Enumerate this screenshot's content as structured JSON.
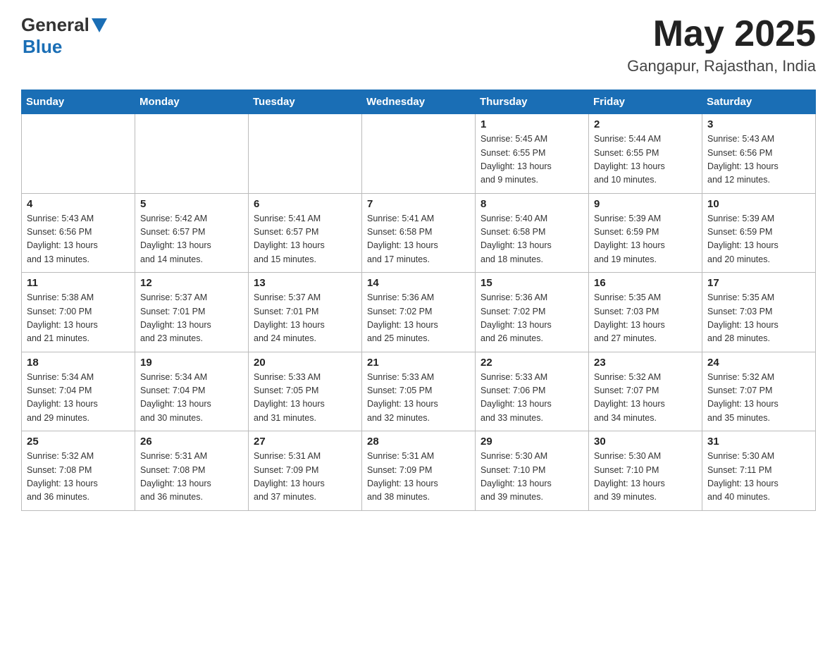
{
  "header": {
    "logo": {
      "general": "General",
      "blue": "Blue"
    },
    "title": "May 2025",
    "location": "Gangapur, Rajasthan, India"
  },
  "weekdays": [
    "Sunday",
    "Monday",
    "Tuesday",
    "Wednesday",
    "Thursday",
    "Friday",
    "Saturday"
  ],
  "weeks": [
    [
      {
        "day": "",
        "info": ""
      },
      {
        "day": "",
        "info": ""
      },
      {
        "day": "",
        "info": ""
      },
      {
        "day": "",
        "info": ""
      },
      {
        "day": "1",
        "info": "Sunrise: 5:45 AM\nSunset: 6:55 PM\nDaylight: 13 hours\nand 9 minutes."
      },
      {
        "day": "2",
        "info": "Sunrise: 5:44 AM\nSunset: 6:55 PM\nDaylight: 13 hours\nand 10 minutes."
      },
      {
        "day": "3",
        "info": "Sunrise: 5:43 AM\nSunset: 6:56 PM\nDaylight: 13 hours\nand 12 minutes."
      }
    ],
    [
      {
        "day": "4",
        "info": "Sunrise: 5:43 AM\nSunset: 6:56 PM\nDaylight: 13 hours\nand 13 minutes."
      },
      {
        "day": "5",
        "info": "Sunrise: 5:42 AM\nSunset: 6:57 PM\nDaylight: 13 hours\nand 14 minutes."
      },
      {
        "day": "6",
        "info": "Sunrise: 5:41 AM\nSunset: 6:57 PM\nDaylight: 13 hours\nand 15 minutes."
      },
      {
        "day": "7",
        "info": "Sunrise: 5:41 AM\nSunset: 6:58 PM\nDaylight: 13 hours\nand 17 minutes."
      },
      {
        "day": "8",
        "info": "Sunrise: 5:40 AM\nSunset: 6:58 PM\nDaylight: 13 hours\nand 18 minutes."
      },
      {
        "day": "9",
        "info": "Sunrise: 5:39 AM\nSunset: 6:59 PM\nDaylight: 13 hours\nand 19 minutes."
      },
      {
        "day": "10",
        "info": "Sunrise: 5:39 AM\nSunset: 6:59 PM\nDaylight: 13 hours\nand 20 minutes."
      }
    ],
    [
      {
        "day": "11",
        "info": "Sunrise: 5:38 AM\nSunset: 7:00 PM\nDaylight: 13 hours\nand 21 minutes."
      },
      {
        "day": "12",
        "info": "Sunrise: 5:37 AM\nSunset: 7:01 PM\nDaylight: 13 hours\nand 23 minutes."
      },
      {
        "day": "13",
        "info": "Sunrise: 5:37 AM\nSunset: 7:01 PM\nDaylight: 13 hours\nand 24 minutes."
      },
      {
        "day": "14",
        "info": "Sunrise: 5:36 AM\nSunset: 7:02 PM\nDaylight: 13 hours\nand 25 minutes."
      },
      {
        "day": "15",
        "info": "Sunrise: 5:36 AM\nSunset: 7:02 PM\nDaylight: 13 hours\nand 26 minutes."
      },
      {
        "day": "16",
        "info": "Sunrise: 5:35 AM\nSunset: 7:03 PM\nDaylight: 13 hours\nand 27 minutes."
      },
      {
        "day": "17",
        "info": "Sunrise: 5:35 AM\nSunset: 7:03 PM\nDaylight: 13 hours\nand 28 minutes."
      }
    ],
    [
      {
        "day": "18",
        "info": "Sunrise: 5:34 AM\nSunset: 7:04 PM\nDaylight: 13 hours\nand 29 minutes."
      },
      {
        "day": "19",
        "info": "Sunrise: 5:34 AM\nSunset: 7:04 PM\nDaylight: 13 hours\nand 30 minutes."
      },
      {
        "day": "20",
        "info": "Sunrise: 5:33 AM\nSunset: 7:05 PM\nDaylight: 13 hours\nand 31 minutes."
      },
      {
        "day": "21",
        "info": "Sunrise: 5:33 AM\nSunset: 7:05 PM\nDaylight: 13 hours\nand 32 minutes."
      },
      {
        "day": "22",
        "info": "Sunrise: 5:33 AM\nSunset: 7:06 PM\nDaylight: 13 hours\nand 33 minutes."
      },
      {
        "day": "23",
        "info": "Sunrise: 5:32 AM\nSunset: 7:07 PM\nDaylight: 13 hours\nand 34 minutes."
      },
      {
        "day": "24",
        "info": "Sunrise: 5:32 AM\nSunset: 7:07 PM\nDaylight: 13 hours\nand 35 minutes."
      }
    ],
    [
      {
        "day": "25",
        "info": "Sunrise: 5:32 AM\nSunset: 7:08 PM\nDaylight: 13 hours\nand 36 minutes."
      },
      {
        "day": "26",
        "info": "Sunrise: 5:31 AM\nSunset: 7:08 PM\nDaylight: 13 hours\nand 36 minutes."
      },
      {
        "day": "27",
        "info": "Sunrise: 5:31 AM\nSunset: 7:09 PM\nDaylight: 13 hours\nand 37 minutes."
      },
      {
        "day": "28",
        "info": "Sunrise: 5:31 AM\nSunset: 7:09 PM\nDaylight: 13 hours\nand 38 minutes."
      },
      {
        "day": "29",
        "info": "Sunrise: 5:30 AM\nSunset: 7:10 PM\nDaylight: 13 hours\nand 39 minutes."
      },
      {
        "day": "30",
        "info": "Sunrise: 5:30 AM\nSunset: 7:10 PM\nDaylight: 13 hours\nand 39 minutes."
      },
      {
        "day": "31",
        "info": "Sunrise: 5:30 AM\nSunset: 7:11 PM\nDaylight: 13 hours\nand 40 minutes."
      }
    ]
  ]
}
